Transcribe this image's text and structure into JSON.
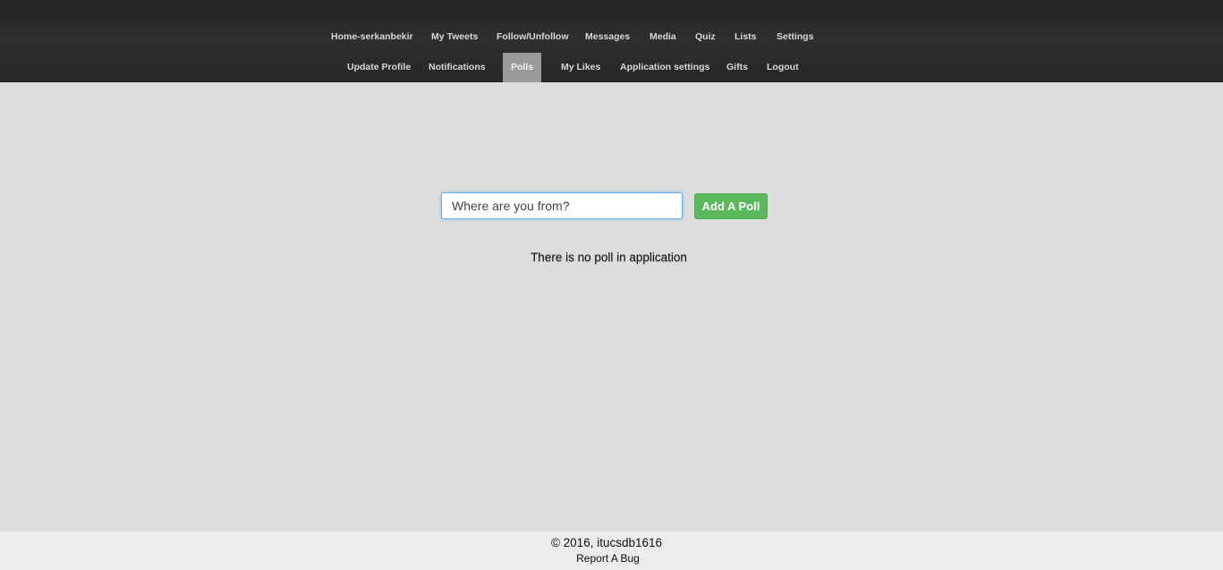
{
  "nav": {
    "row1": [
      {
        "label": "Home-serkanbekir"
      },
      {
        "label": "My Tweets"
      },
      {
        "label": "Follow/Unfollow"
      },
      {
        "label": "Messages"
      },
      {
        "label": "Media"
      },
      {
        "label": "Quiz"
      },
      {
        "label": "Lists"
      },
      {
        "label": "Settings"
      }
    ],
    "row2": [
      {
        "label": "Update Profile"
      },
      {
        "label": "Notifications"
      },
      {
        "label": "Polls",
        "active": true
      },
      {
        "label": "My Likes"
      },
      {
        "label": "Application settings"
      },
      {
        "label": "Gifts"
      },
      {
        "label": "Logout"
      }
    ]
  },
  "poll_form": {
    "input_value": "Where are you from?",
    "submit_label": "Add A Poll"
  },
  "empty_message": "There is no poll in application",
  "footer": {
    "copyright": "© 2016, itucsdb1616",
    "report_link": "Report A Bug"
  },
  "colors": {
    "topbar": "#2b2b2b",
    "background": "#dddddd",
    "active_tab": "#9a9a9a",
    "add_button": "#5cb85c",
    "footer": "#ececec"
  }
}
